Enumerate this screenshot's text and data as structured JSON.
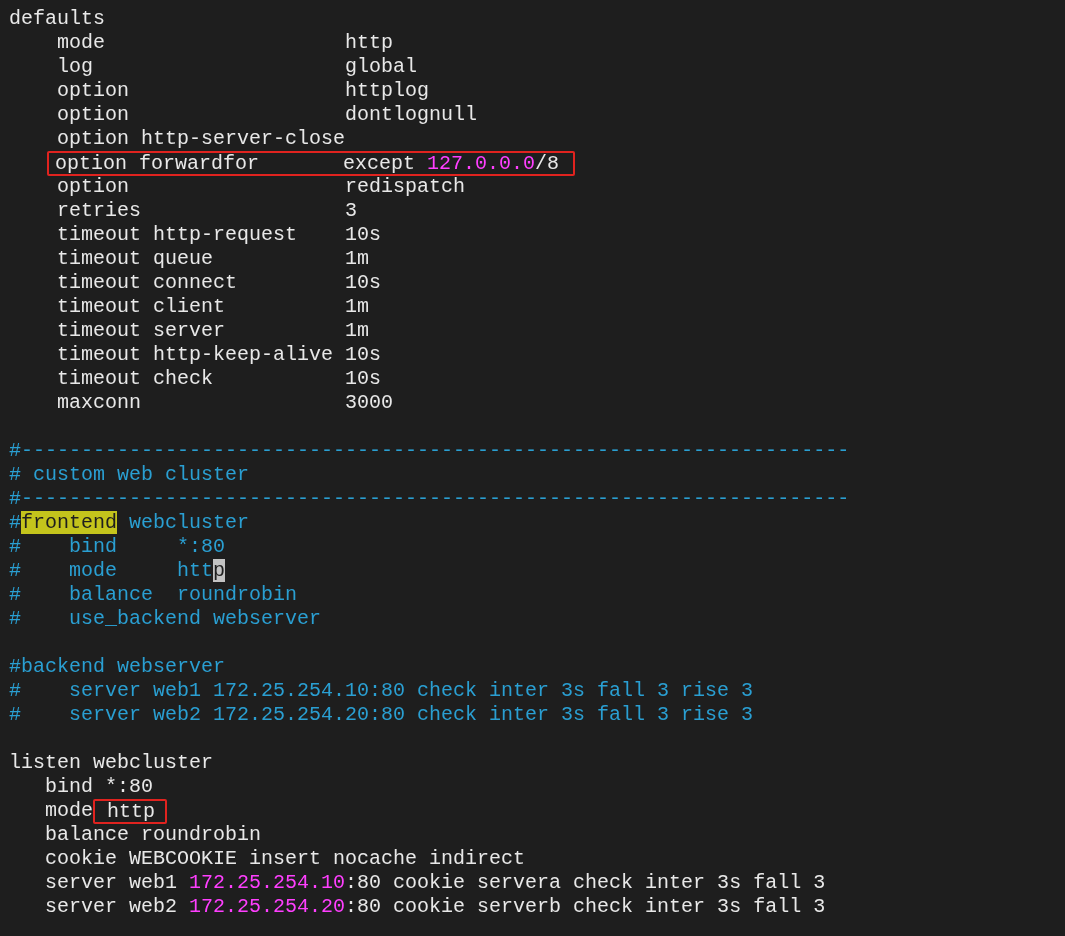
{
  "lines": [
    {
      "kind": "code",
      "segments": [
        {
          "text": "defaults",
          "kind": "text"
        }
      ]
    },
    {
      "kind": "code",
      "segments": [
        {
          "text": "    mode                    http",
          "kind": "text"
        }
      ]
    },
    {
      "kind": "code",
      "segments": [
        {
          "text": "    log                     global",
          "kind": "text"
        }
      ]
    },
    {
      "kind": "code",
      "segments": [
        {
          "text": "    option                  httplog",
          "kind": "text"
        }
      ]
    },
    {
      "kind": "code",
      "segments": [
        {
          "text": "    option                  dontlognull",
          "kind": "text"
        }
      ]
    },
    {
      "kind": "code",
      "segments": [
        {
          "text": "    option http-server-close",
          "kind": "text"
        }
      ]
    },
    {
      "kind": "annotated",
      "box": {
        "segments": [
          {
            "text": "option forwardfor       except ",
            "kind": "text"
          },
          {
            "text": "127.0.0.0",
            "kind": "number"
          },
          {
            "text": "/8",
            "kind": "text"
          }
        ]
      }
    },
    {
      "kind": "code",
      "segments": [
        {
          "text": "    option                  redispatch",
          "kind": "text"
        }
      ]
    },
    {
      "kind": "code",
      "segments": [
        {
          "text": "    retries                 3",
          "kind": "text"
        }
      ]
    },
    {
      "kind": "code",
      "segments": [
        {
          "text": "    timeout http-request    10s",
          "kind": "text"
        }
      ]
    },
    {
      "kind": "code",
      "segments": [
        {
          "text": "    timeout queue           1m",
          "kind": "text"
        }
      ]
    },
    {
      "kind": "code",
      "segments": [
        {
          "text": "    timeout connect         10s",
          "kind": "text"
        }
      ]
    },
    {
      "kind": "code",
      "segments": [
        {
          "text": "    timeout client          1m",
          "kind": "text"
        }
      ]
    },
    {
      "kind": "code",
      "segments": [
        {
          "text": "    timeout server          1m",
          "kind": "text"
        }
      ]
    },
    {
      "kind": "code",
      "segments": [
        {
          "text": "    timeout http-keep-alive 10s",
          "kind": "text"
        }
      ]
    },
    {
      "kind": "code",
      "segments": [
        {
          "text": "    timeout check           10s",
          "kind": "text"
        }
      ]
    },
    {
      "kind": "code",
      "segments": [
        {
          "text": "    maxconn                 3000",
          "kind": "text"
        }
      ]
    },
    {
      "kind": "blank"
    },
    {
      "kind": "code",
      "segments": [
        {
          "text": "#---------------------------------------------------------------------",
          "kind": "comment"
        }
      ]
    },
    {
      "kind": "code",
      "segments": [
        {
          "text": "# custom web cluster",
          "kind": "comment"
        }
      ]
    },
    {
      "kind": "code",
      "segments": [
        {
          "text": "#---------------------------------------------------------------------",
          "kind": "comment"
        }
      ]
    },
    {
      "kind": "code",
      "segments": [
        {
          "text": "#",
          "kind": "comment"
        },
        {
          "text": "frontend",
          "kind": "search"
        },
        {
          "text": " webcluster",
          "kind": "comment"
        }
      ]
    },
    {
      "kind": "code",
      "segments": [
        {
          "text": "#    bind     *:80",
          "kind": "comment"
        }
      ]
    },
    {
      "kind": "code",
      "segments": [
        {
          "text": "#    mode     htt",
          "kind": "comment"
        },
        {
          "text": "p",
          "kind": "cursor"
        }
      ]
    },
    {
      "kind": "code",
      "segments": [
        {
          "text": "#    balance  roundrobin",
          "kind": "comment"
        }
      ]
    },
    {
      "kind": "code",
      "segments": [
        {
          "text": "#    use_backend webserver",
          "kind": "comment"
        }
      ]
    },
    {
      "kind": "blank"
    },
    {
      "kind": "code",
      "segments": [
        {
          "text": "#backend webserver",
          "kind": "comment"
        }
      ]
    },
    {
      "kind": "code",
      "segments": [
        {
          "text": "#    server web1 172.25.254.10:80 check inter 3s fall 3 rise 3",
          "kind": "comment"
        }
      ]
    },
    {
      "kind": "code",
      "segments": [
        {
          "text": "#    server web2 172.25.254.20:80 check inter 3s fall 3 rise 3",
          "kind": "comment"
        }
      ]
    },
    {
      "kind": "blank"
    },
    {
      "kind": "code",
      "segments": [
        {
          "text": "listen webcluster",
          "kind": "text"
        }
      ]
    },
    {
      "kind": "code",
      "segments": [
        {
          "text": "   bind *:80",
          "kind": "text"
        }
      ]
    },
    {
      "kind": "annotated",
      "segments": [
        {
          "text": "   mode",
          "kind": "text"
        }
      ],
      "box": {
        "segments": [
          {
            "text": " http",
            "kind": "text"
          }
        ]
      }
    },
    {
      "kind": "code",
      "segments": [
        {
          "text": "   balance roundrobin",
          "kind": "text"
        }
      ]
    },
    {
      "kind": "code",
      "segments": [
        {
          "text": "   cookie WEBCOOKIE insert nocache indirect",
          "kind": "text"
        }
      ]
    },
    {
      "kind": "code",
      "segments": [
        {
          "text": "   server web1 ",
          "kind": "text"
        },
        {
          "text": "172.25.254.10",
          "kind": "number"
        },
        {
          "text": ":80 cookie servera check inter 3s fall 3",
          "kind": "text"
        }
      ]
    },
    {
      "kind": "code",
      "segments": [
        {
          "text": "   server web2 ",
          "kind": "text"
        },
        {
          "text": "172.25.254.20",
          "kind": "number"
        },
        {
          "text": ":80 cookie serverb check inter 3s fall 3",
          "kind": "text"
        }
      ]
    }
  ]
}
